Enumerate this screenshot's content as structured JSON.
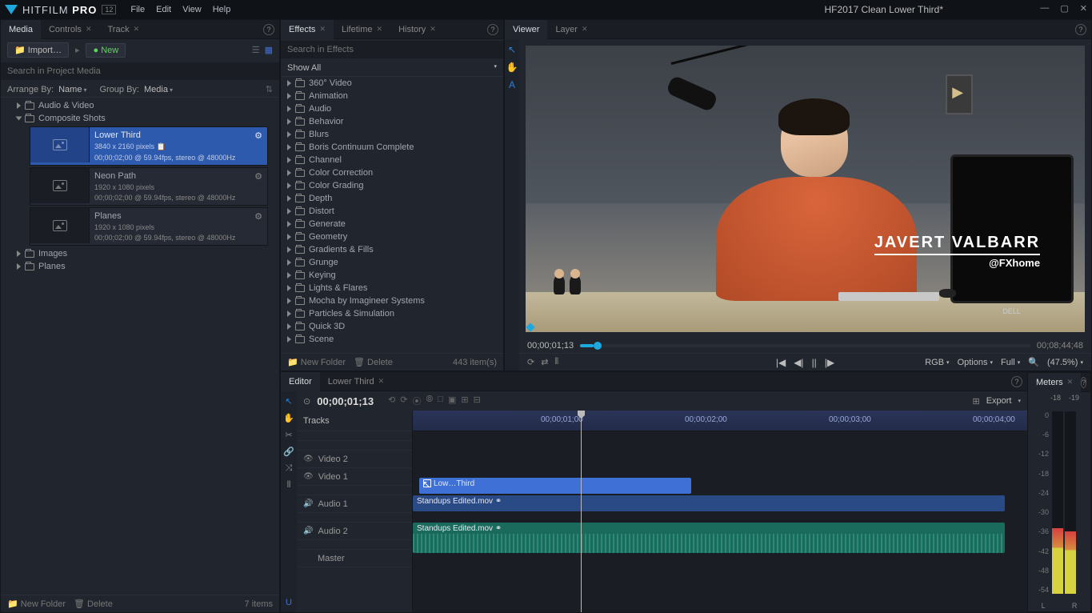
{
  "app": {
    "brand_left": "HITFILM",
    "brand_right": "PRO",
    "version": "12",
    "project": "HF2017 Clean Lower Third*"
  },
  "menu": [
    "File",
    "Edit",
    "View",
    "Help"
  ],
  "media": {
    "tabs": [
      "Media",
      "Controls",
      "Track"
    ],
    "import": "Import…",
    "new": "New",
    "search_ph": "Search in Project Media",
    "arrange_lbl": "Arrange By:",
    "arrange_val": "Name",
    "group_lbl": "Group By:",
    "group_val": "Media",
    "folders": [
      {
        "name": "Audio & Video",
        "open": false
      },
      {
        "name": "Composite Shots",
        "open": true
      }
    ],
    "comps": [
      {
        "title": "Lower Third",
        "dims": "3840 x 2160 pixels",
        "meta": "00;00;02;00 @ 59.94fps, stereo @ 48000Hz",
        "sel": true
      },
      {
        "title": "Neon Path",
        "dims": "1920 x 1080 pixels",
        "meta": "00;00;02;00 @ 59.94fps, stereo @ 48000Hz",
        "sel": false
      },
      {
        "title": "Planes",
        "dims": "1920 x 1080 pixels",
        "meta": "00;00;02;00 @ 59.94fps, stereo @ 48000Hz",
        "sel": false
      }
    ],
    "other_folders": [
      "Images",
      "Planes"
    ],
    "footer_new": "New Folder",
    "footer_del": "Delete",
    "footer_count": "7 items"
  },
  "effects": {
    "tabs": [
      "Effects",
      "Lifetime",
      "History"
    ],
    "search_ph": "Search in Effects",
    "show_all": "Show All",
    "cats": [
      "360° Video",
      "Animation",
      "Audio",
      "Behavior",
      "Blurs",
      "Boris Continuum Complete",
      "Channel",
      "Color Correction",
      "Color Grading",
      "Depth",
      "Distort",
      "Generate",
      "Geometry",
      "Gradients & Fills",
      "Grunge",
      "Keying",
      "Lights & Flares",
      "Mocha by Imagineer Systems",
      "Particles & Simulation",
      "Quick 3D",
      "Scene"
    ],
    "footer_new": "New Folder",
    "footer_del": "Delete",
    "footer_count": "443 item(s)"
  },
  "viewer": {
    "tabs": [
      "Viewer",
      "Layer"
    ],
    "tc": "00;00;01;13",
    "dur": "00;08;44;48",
    "lt_name": "JAVERT VALBARR",
    "lt_handle": "@FXhome",
    "opts": {
      "rgb": "RGB",
      "options": "Options",
      "full": "Full",
      "zoom": "(47.5%)"
    }
  },
  "editor": {
    "tabs": [
      "Editor",
      "Lower Third"
    ],
    "tc": "00;00;01;13",
    "tracks_lbl": "Tracks",
    "export": "Export",
    "ruler": [
      "00;00;01;00",
      "00;00;02;00",
      "00;00;03;00",
      "00;00;04;00"
    ],
    "track_names": {
      "v2": "Video 2",
      "v1": "Video 1",
      "a1": "Audio 1",
      "a2": "Audio 2",
      "master": "Master"
    },
    "clips": {
      "comp": "Low…Third",
      "video": "Standups Edited.mov",
      "audio": "Standups Edited.mov"
    }
  },
  "meters": {
    "tab": "Meters",
    "peaks": [
      "-18",
      "-19"
    ],
    "scale": [
      "0",
      "-6",
      "-12",
      "-18",
      "-24",
      "-30",
      "-36",
      "-42",
      "-48",
      "-54"
    ],
    "LR": [
      "L",
      "R"
    ]
  }
}
